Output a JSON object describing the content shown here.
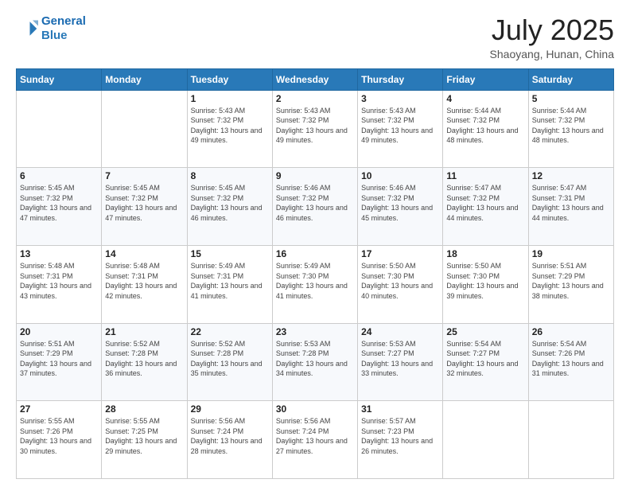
{
  "header": {
    "logo_line1": "General",
    "logo_line2": "Blue",
    "title": "July 2025",
    "subtitle": "Shaoyang, Hunan, China"
  },
  "days_of_week": [
    "Sunday",
    "Monday",
    "Tuesday",
    "Wednesday",
    "Thursday",
    "Friday",
    "Saturday"
  ],
  "weeks": [
    [
      {
        "day": "",
        "info": ""
      },
      {
        "day": "",
        "info": ""
      },
      {
        "day": "1",
        "info": "Sunrise: 5:43 AM\nSunset: 7:32 PM\nDaylight: 13 hours and 49 minutes."
      },
      {
        "day": "2",
        "info": "Sunrise: 5:43 AM\nSunset: 7:32 PM\nDaylight: 13 hours and 49 minutes."
      },
      {
        "day": "3",
        "info": "Sunrise: 5:43 AM\nSunset: 7:32 PM\nDaylight: 13 hours and 49 minutes."
      },
      {
        "day": "4",
        "info": "Sunrise: 5:44 AM\nSunset: 7:32 PM\nDaylight: 13 hours and 48 minutes."
      },
      {
        "day": "5",
        "info": "Sunrise: 5:44 AM\nSunset: 7:32 PM\nDaylight: 13 hours and 48 minutes."
      }
    ],
    [
      {
        "day": "6",
        "info": "Sunrise: 5:45 AM\nSunset: 7:32 PM\nDaylight: 13 hours and 47 minutes."
      },
      {
        "day": "7",
        "info": "Sunrise: 5:45 AM\nSunset: 7:32 PM\nDaylight: 13 hours and 47 minutes."
      },
      {
        "day": "8",
        "info": "Sunrise: 5:45 AM\nSunset: 7:32 PM\nDaylight: 13 hours and 46 minutes."
      },
      {
        "day": "9",
        "info": "Sunrise: 5:46 AM\nSunset: 7:32 PM\nDaylight: 13 hours and 46 minutes."
      },
      {
        "day": "10",
        "info": "Sunrise: 5:46 AM\nSunset: 7:32 PM\nDaylight: 13 hours and 45 minutes."
      },
      {
        "day": "11",
        "info": "Sunrise: 5:47 AM\nSunset: 7:32 PM\nDaylight: 13 hours and 44 minutes."
      },
      {
        "day": "12",
        "info": "Sunrise: 5:47 AM\nSunset: 7:31 PM\nDaylight: 13 hours and 44 minutes."
      }
    ],
    [
      {
        "day": "13",
        "info": "Sunrise: 5:48 AM\nSunset: 7:31 PM\nDaylight: 13 hours and 43 minutes."
      },
      {
        "day": "14",
        "info": "Sunrise: 5:48 AM\nSunset: 7:31 PM\nDaylight: 13 hours and 42 minutes."
      },
      {
        "day": "15",
        "info": "Sunrise: 5:49 AM\nSunset: 7:31 PM\nDaylight: 13 hours and 41 minutes."
      },
      {
        "day": "16",
        "info": "Sunrise: 5:49 AM\nSunset: 7:30 PM\nDaylight: 13 hours and 41 minutes."
      },
      {
        "day": "17",
        "info": "Sunrise: 5:50 AM\nSunset: 7:30 PM\nDaylight: 13 hours and 40 minutes."
      },
      {
        "day": "18",
        "info": "Sunrise: 5:50 AM\nSunset: 7:30 PM\nDaylight: 13 hours and 39 minutes."
      },
      {
        "day": "19",
        "info": "Sunrise: 5:51 AM\nSunset: 7:29 PM\nDaylight: 13 hours and 38 minutes."
      }
    ],
    [
      {
        "day": "20",
        "info": "Sunrise: 5:51 AM\nSunset: 7:29 PM\nDaylight: 13 hours and 37 minutes."
      },
      {
        "day": "21",
        "info": "Sunrise: 5:52 AM\nSunset: 7:28 PM\nDaylight: 13 hours and 36 minutes."
      },
      {
        "day": "22",
        "info": "Sunrise: 5:52 AM\nSunset: 7:28 PM\nDaylight: 13 hours and 35 minutes."
      },
      {
        "day": "23",
        "info": "Sunrise: 5:53 AM\nSunset: 7:28 PM\nDaylight: 13 hours and 34 minutes."
      },
      {
        "day": "24",
        "info": "Sunrise: 5:53 AM\nSunset: 7:27 PM\nDaylight: 13 hours and 33 minutes."
      },
      {
        "day": "25",
        "info": "Sunrise: 5:54 AM\nSunset: 7:27 PM\nDaylight: 13 hours and 32 minutes."
      },
      {
        "day": "26",
        "info": "Sunrise: 5:54 AM\nSunset: 7:26 PM\nDaylight: 13 hours and 31 minutes."
      }
    ],
    [
      {
        "day": "27",
        "info": "Sunrise: 5:55 AM\nSunset: 7:26 PM\nDaylight: 13 hours and 30 minutes."
      },
      {
        "day": "28",
        "info": "Sunrise: 5:55 AM\nSunset: 7:25 PM\nDaylight: 13 hours and 29 minutes."
      },
      {
        "day": "29",
        "info": "Sunrise: 5:56 AM\nSunset: 7:24 PM\nDaylight: 13 hours and 28 minutes."
      },
      {
        "day": "30",
        "info": "Sunrise: 5:56 AM\nSunset: 7:24 PM\nDaylight: 13 hours and 27 minutes."
      },
      {
        "day": "31",
        "info": "Sunrise: 5:57 AM\nSunset: 7:23 PM\nDaylight: 13 hours and 26 minutes."
      },
      {
        "day": "",
        "info": ""
      },
      {
        "day": "",
        "info": ""
      }
    ]
  ]
}
